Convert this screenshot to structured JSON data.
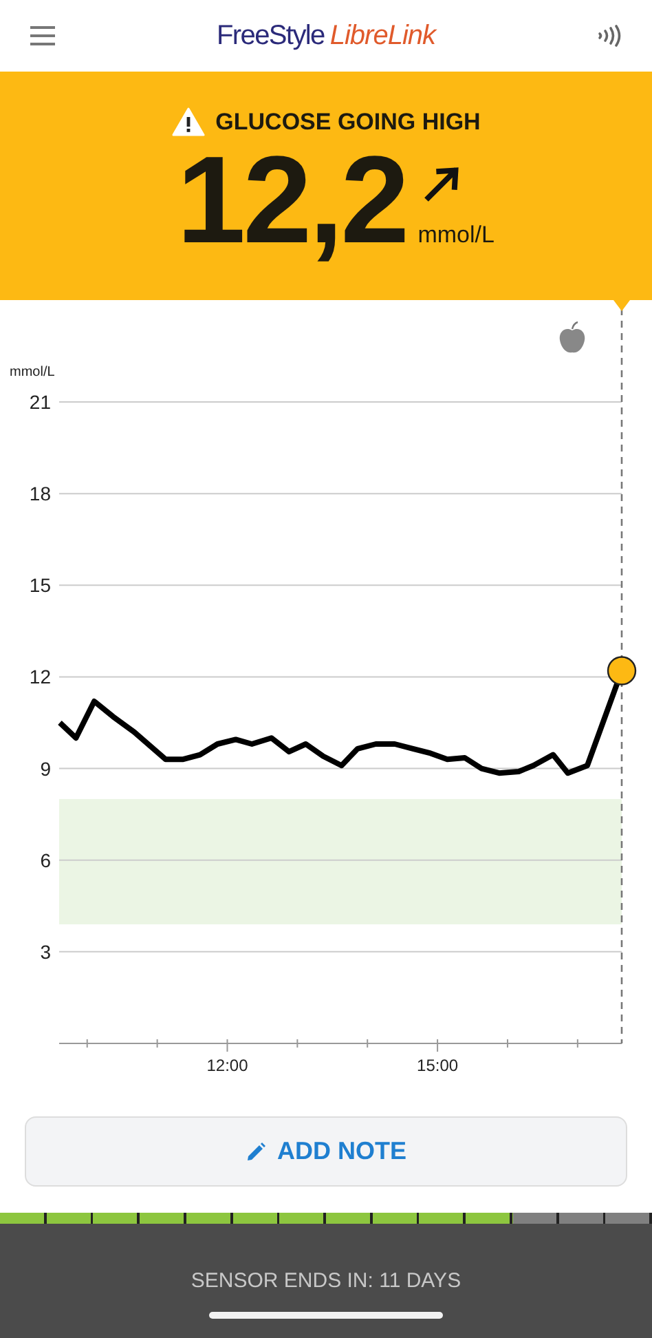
{
  "header": {
    "brand_first": "FreeStyle",
    "brand_second": "LibreLink"
  },
  "alert": {
    "kind": "high",
    "message": "GLUCOSE GOING HIGH",
    "value": "12,2",
    "unit": "mmol/L"
  },
  "graph": {
    "unit_label": "mmol/L",
    "chart_data": {
      "type": "line",
      "grid": true,
      "xlim": [
        9.6,
        17.63
      ],
      "ylim": [
        0,
        21
      ],
      "x": [
        9.61,
        9.84,
        10.1,
        10.37,
        10.67,
        11.12,
        11.37,
        11.61,
        11.86,
        12.12,
        12.35,
        12.63,
        12.88,
        13.12,
        13.37,
        13.63,
        13.86,
        14.12,
        14.39,
        14.65,
        14.9,
        15.14,
        15.39,
        15.63,
        15.88,
        16.16,
        16.37,
        16.65,
        16.86,
        17.14,
        17.63
      ],
      "series": [
        {
          "color": "#000000",
          "values": [
            10.5,
            10.0,
            11.2,
            10.7,
            10.2,
            9.3,
            9.3,
            9.45,
            9.8,
            9.95,
            9.8,
            10.0,
            9.55,
            9.8,
            9.4,
            9.1,
            9.65,
            9.8,
            9.8,
            9.65,
            9.5,
            9.3,
            9.35,
            9.0,
            8.85,
            8.9,
            9.1,
            9.45,
            8.85,
            9.1,
            12.2
          ]
        }
      ],
      "yticks": [
        3,
        6,
        9,
        12,
        15,
        18,
        21
      ],
      "xticks": [
        {
          "value": 12,
          "label": "12:00"
        },
        {
          "value": 15,
          "label": "15:00"
        }
      ],
      "bands": [
        {
          "axis": "y",
          "from": 3.9,
          "to": 8
        }
      ]
    }
  },
  "add_note": {
    "label": "ADD NOTE"
  },
  "sensor": {
    "level": 0.786,
    "text": "SENSOR ENDS IN: 11 DAYS"
  }
}
